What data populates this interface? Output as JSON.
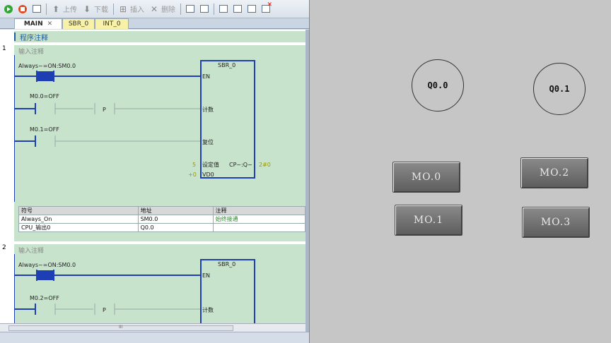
{
  "toolbar": {
    "upload_label": "上传",
    "download_label": "下载",
    "insert_label": "插入",
    "delete_label": "删除"
  },
  "tabs": [
    {
      "label": "MAIN"
    },
    {
      "label": "SBR_0"
    },
    {
      "label": "INT_0"
    }
  ],
  "program_comment": "程序注释",
  "networks": [
    {
      "number": "1",
      "comment": "输入注释",
      "contacts": [
        {
          "label": "Always~=ON:SM0.0"
        },
        {
          "label": "M0.0=OFF"
        },
        {
          "label": "M0.1=OFF"
        }
      ],
      "block": {
        "name": "SBR_0",
        "en": "EN",
        "count": "计数",
        "reset": "复位",
        "setpoint": "设定值",
        "cpq": "CP~:Q~",
        "output_value": "2#0",
        "vd": "VD0",
        "setpoint_value": "5",
        "vd_value": "+0"
      },
      "p_label": "P",
      "symbol_table": {
        "headers": [
          "符号",
          "地址",
          "注释"
        ],
        "rows": [
          [
            "Always_On",
            "SM0.0",
            "始终接通"
          ],
          [
            "CPU_输出0",
            "Q0.0",
            ""
          ]
        ]
      }
    },
    {
      "number": "2",
      "comment": "输入注释",
      "contacts": [
        {
          "label": "Always~=ON:SM0.0"
        },
        {
          "label": "M0.2=OFF"
        }
      ],
      "block": {
        "name": "SBR_0",
        "en": "EN",
        "count": "计数"
      },
      "p_label": "P"
    }
  ],
  "hscroll_grip": "III",
  "hmi": {
    "lamps": [
      "Q0.0",
      "Q0.1"
    ],
    "buttons": [
      "MO.0",
      "MO.1",
      "MO.2",
      "MO.3"
    ]
  }
}
